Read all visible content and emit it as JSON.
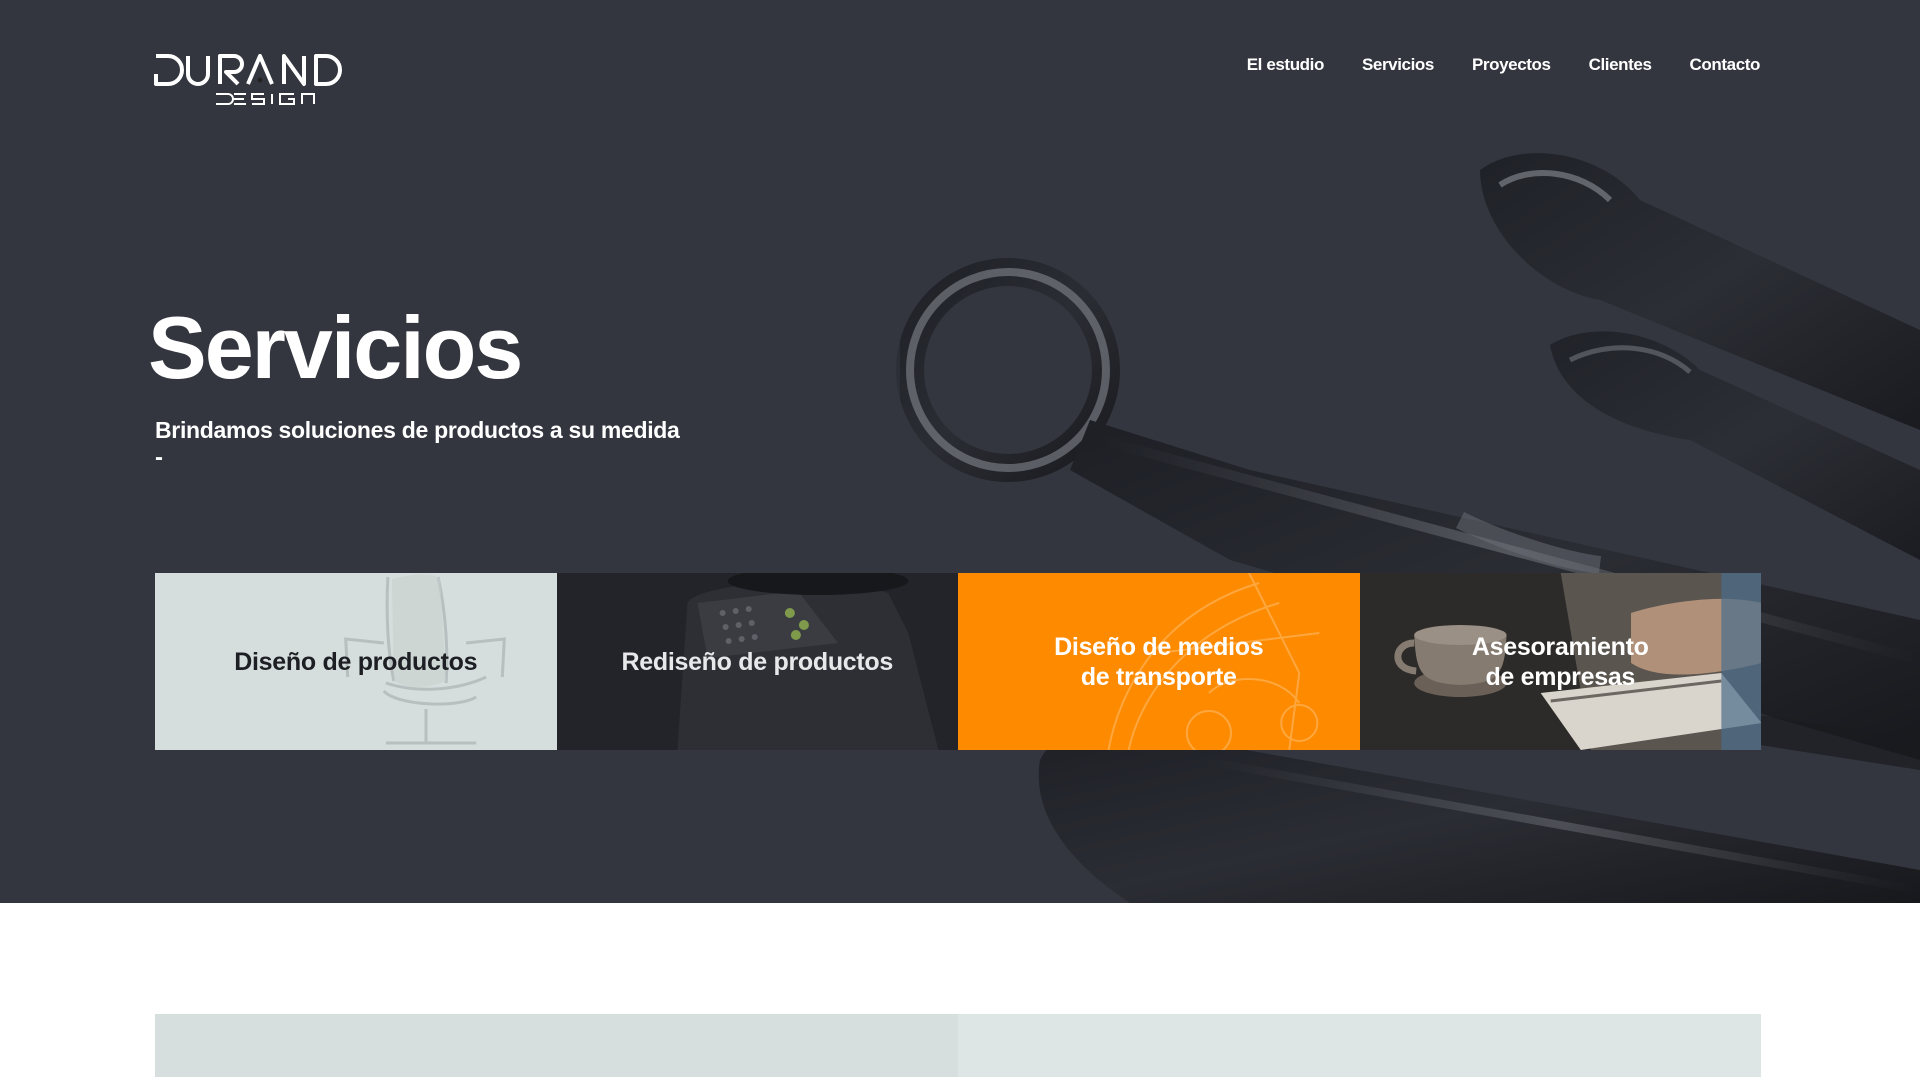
{
  "brand": {
    "logo_main": "DURAND",
    "logo_sub": "DESIGN"
  },
  "nav": {
    "items": [
      "El estudio",
      "Servicios",
      "Proyectos",
      "Clientes",
      "Contacto"
    ]
  },
  "hero": {
    "title": "Servicios",
    "subtitle": "Brindamos soluciones de productos a su medida",
    "subtitle_mark": "-"
  },
  "services": [
    {
      "label": "Diseño de productos",
      "image": "office-chair"
    },
    {
      "label": "Rediseño de productos",
      "image": "control-panel-device"
    },
    {
      "label": "Diseño de medios\nde transporte",
      "image": "vehicle-sketch"
    },
    {
      "label": "Asesoramiento\nde empresas",
      "image": "mug-and-notebook"
    }
  ],
  "colors": {
    "hero_bg": "#33363f",
    "accent": "#fe8a00",
    "card_light": "#d6dedd",
    "card_dark": "#22242a",
    "lower_panel": "#d7dfde"
  }
}
